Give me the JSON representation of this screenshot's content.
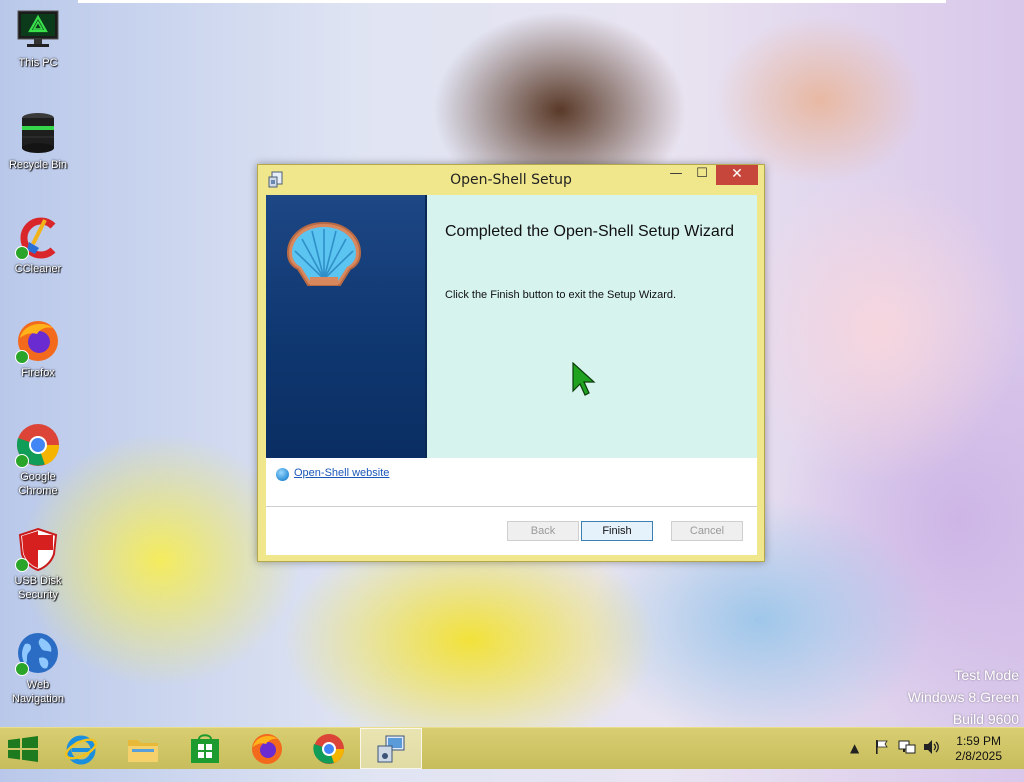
{
  "desktop": {
    "icons": [
      {
        "label": "This PC",
        "icon": "this-pc-icon"
      },
      {
        "label": "Recycle Bin",
        "icon": "recycle-bin-icon"
      },
      {
        "label": "CCleaner",
        "icon": "ccleaner-icon"
      },
      {
        "label": "Firefox",
        "icon": "firefox-icon"
      },
      {
        "label": "Google Chrome",
        "icon": "chrome-icon"
      },
      {
        "label": "USB Disk Security",
        "icon": "usb-disk-security-icon"
      },
      {
        "label": "Web Navigation",
        "icon": "web-navigation-icon"
      }
    ]
  },
  "dialog": {
    "title": "Open-Shell Setup",
    "close_symbol": "✕",
    "heading": "Completed the Open-Shell Setup Wizard",
    "description": "Click the Finish button to exit the Setup Wizard.",
    "link_text": "Open-Shell website",
    "buttons": {
      "back": "Back",
      "finish": "Finish",
      "cancel": "Cancel"
    }
  },
  "watermark": {
    "line1": "Test Mode",
    "line2": "Windows 8.Green",
    "line3": "Build 9600"
  },
  "taskbar": {
    "apps": [
      "start-icon",
      "internet-explorer-icon",
      "file-explorer-icon",
      "store-icon",
      "firefox-icon",
      "chrome-icon",
      "setup-icon"
    ],
    "tray": {
      "time": "1:59 PM",
      "date": "2/8/2025"
    }
  },
  "colors": {
    "window_frame": "#f0e68c",
    "close_button": "#c7463b",
    "banner": "#0f3770",
    "content_bg": "#d6f3ee",
    "taskbar": "#cdc260",
    "link": "#1a57b8"
  }
}
